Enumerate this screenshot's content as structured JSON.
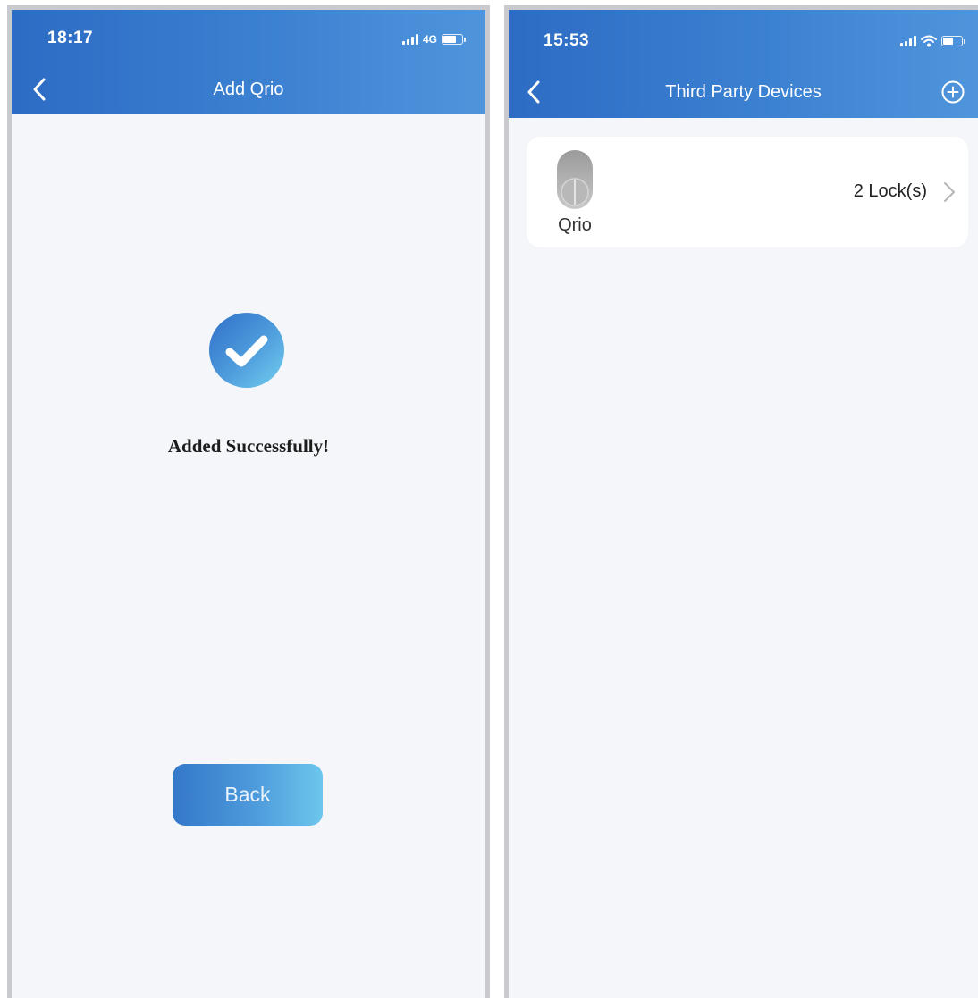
{
  "left_screen": {
    "status_bar": {
      "time": "18:17",
      "network": "4G"
    },
    "header": {
      "title": "Add Qrio"
    },
    "message": "Added Successfully!",
    "back_button_label": "Back"
  },
  "right_screen": {
    "status_bar": {
      "time": "15:53"
    },
    "header": {
      "title": "Third Party Devices"
    },
    "devices": [
      {
        "name": "Qrio",
        "count_label": "2 Lock(s)"
      }
    ]
  },
  "colors": {
    "header_blue": "#3a7fd0",
    "background": "#f4f6fa",
    "success_gradient_start": "#2f6fc7",
    "success_gradient_end": "#72cfee"
  },
  "icons": [
    "back-chevron-icon",
    "checkmark-icon",
    "add-circle-icon",
    "lock-icon",
    "chevron-right-icon",
    "signal-icon",
    "wifi-icon",
    "battery-icon"
  ]
}
